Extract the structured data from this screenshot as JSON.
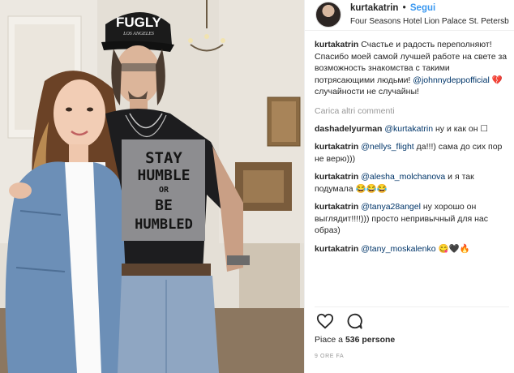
{
  "post": {
    "author": "kurtakatrin",
    "separator": "•",
    "follow_label": "Segui",
    "location": "Four Seasons Hotel Lion Palace St. Petersb",
    "photo_texts": {
      "cap_text": "FUGLY",
      "cap_subtext": "LOS ANGELES",
      "shirt_lines": [
        "STAY",
        "HUMBLE",
        "OR",
        "BE",
        "HUMBLED"
      ]
    }
  },
  "caption": {
    "user": "kurtakatrin",
    "text_before": "Счастье и радость переполняют! Спасибо моей самой лучшей работе на свете за возможность знакомства с такими потрясающими людьми! ",
    "mention": "@johnnydeppofficial",
    "text_after": " 💔 случайности не случайны!"
  },
  "load_more_label": "Carica altri commenti",
  "comments": [
    {
      "user": "dashadelyurman",
      "mention": "@kurtakatrin",
      "text": " ну и как он ☐"
    },
    {
      "user": "kurtakatrin",
      "mention": "@nellys_flight",
      "text": " да!!!) сама до сих пор не верю)))"
    },
    {
      "user": "kurtakatrin",
      "mention": "@alesha_molchanova",
      "text": " и я так подумала 😂😂😂"
    },
    {
      "user": "kurtakatrin",
      "mention": "@tanya28angel",
      "text": " ну хорошо он выглядит!!!!))) просто непривычный для нас образ)"
    },
    {
      "user": "kurtakatrin",
      "mention": "@tany_moskalenko",
      "text": " 😋🖤🔥"
    }
  ],
  "actions": {
    "like_icon": "heart-icon",
    "comment_icon": "comment-bubble-icon"
  },
  "likes": {
    "prefix": "Piace a ",
    "count": "536 persone"
  },
  "time_ago": "9 ORE FA",
  "colors": {
    "link_blue": "#3897f0",
    "mention_navy": "#003569",
    "muted": "#999999",
    "text": "#262626"
  }
}
